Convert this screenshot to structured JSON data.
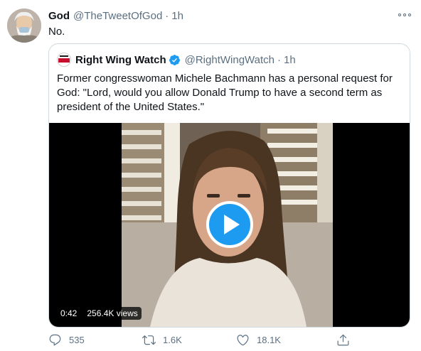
{
  "tweet": {
    "author_name": "God",
    "handle": "@TheTweetOfGod",
    "separator": "·",
    "time": "1h",
    "text": "No."
  },
  "quoted": {
    "author_name": "Right Wing Watch",
    "handle": "@RightWingWatch",
    "separator": "·",
    "time": "1h",
    "text": "Former congresswoman Michele Bachmann has a personal request for God: \"Lord, would you allow Donald Trump to have a second term as president of the United States.\"",
    "video": {
      "duration": "0:42",
      "views": "256.4K views"
    }
  },
  "actions": {
    "reply_count": "535",
    "retweet_count": "1.6K",
    "like_count": "18.1K"
  },
  "colors": {
    "accent": "#1d9bf0",
    "muted": "#5b7083",
    "border": "#cfd9de"
  },
  "icons": [
    "more-icon",
    "verified-icon",
    "play-icon",
    "reply-icon",
    "retweet-icon",
    "like-icon",
    "share-icon"
  ]
}
